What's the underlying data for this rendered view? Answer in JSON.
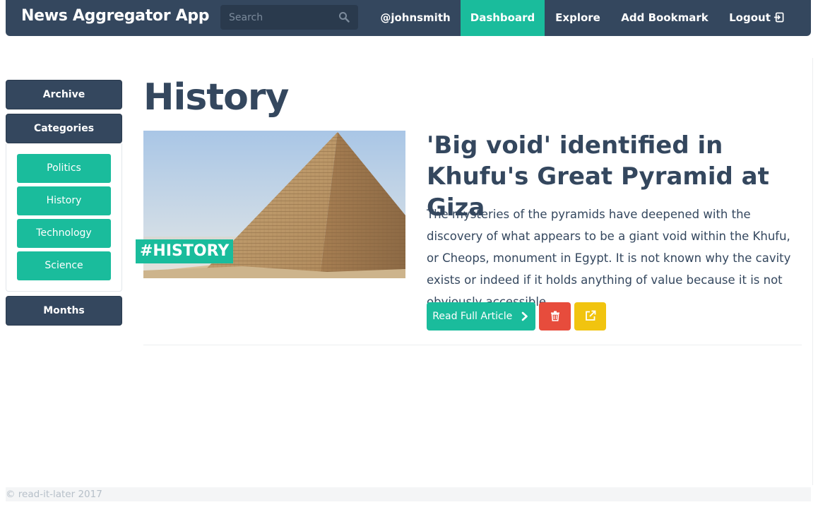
{
  "navbar": {
    "brand": "News Aggregator App",
    "search_placeholder": "Search",
    "user": "@johnsmith",
    "dashboard": "Dashboard",
    "explore": "Explore",
    "add_bookmark": "Add Bookmark",
    "logout": "Logout"
  },
  "sidebar": {
    "archive": "Archive",
    "categories": "Categories",
    "category_items": [
      "Politics",
      "History",
      "Technology",
      "Science"
    ],
    "months": "Months"
  },
  "main": {
    "page_title": "History",
    "article": {
      "tag": "#HISTORY",
      "title": "'Big void' identified in Khufu's Great Pyramid at Giza",
      "description": "The mysteries of the pyramids have deepened with the discovery of what appears to be a giant void within the Khufu, or Cheops, monument in Egypt. It is not known why the cavity exists or indeed if it holds anything of value because it is not obviously accessible.",
      "read_button": "Read Full Article"
    }
  },
  "footer": {
    "text": "© read-it-later 2017"
  },
  "colors": {
    "navbar": "#34475e",
    "accent": "#1abc9c",
    "danger": "#e74c3c",
    "warning": "#f1c40f"
  },
  "icons": {
    "search": "search-icon",
    "logout": "logout-icon",
    "read": "chevron-right-icon",
    "delete": "trash-icon",
    "external": "external-link-icon"
  }
}
